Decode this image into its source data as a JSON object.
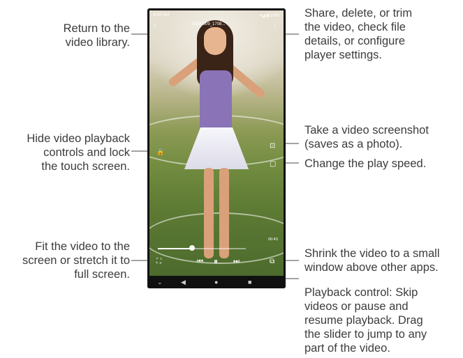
{
  "callouts": {
    "return_library": "Return to the\nvideo library.",
    "hide_controls": "Hide video playback\ncontrols and lock\nthe touch screen.",
    "fit_video": "Fit the video to the\nscreen or stretch it to\nfull screen.",
    "share_menu": "Share, delete, or trim\nthe video, check file\ndetails, or configure\nplayer settings.",
    "screenshot": "Take a video screenshot\n(saves as a photo).",
    "play_speed": "Change the play speed.",
    "shrink_video": "Shrink the video to a small\nwindow above other apps.",
    "playback_control": "Playback control: Skip\nvideos or pause and\nresume playback. Drag\nthe slider to jump to any\npart of the video."
  },
  "phone": {
    "status_time": "8:30 AM",
    "status_icons": "▾◢ ▮100%",
    "video_name": "20200909_1708...",
    "timecode": "00:43",
    "icons": {
      "back": "‹",
      "more": "⋮",
      "lock": "🔒",
      "screenshot": "⊡",
      "speed": "▢",
      "fit": "⛶",
      "prev": "⏮",
      "pause": "⏸",
      "next": "⏭",
      "popup": "⧉",
      "nav_down": "⌄",
      "nav_back": "◀",
      "nav_home": "●",
      "nav_recent": "■"
    }
  },
  "colors": {
    "line": "#3c3c3c",
    "text": "#3c3c3c",
    "phone_frame": "#111111"
  }
}
